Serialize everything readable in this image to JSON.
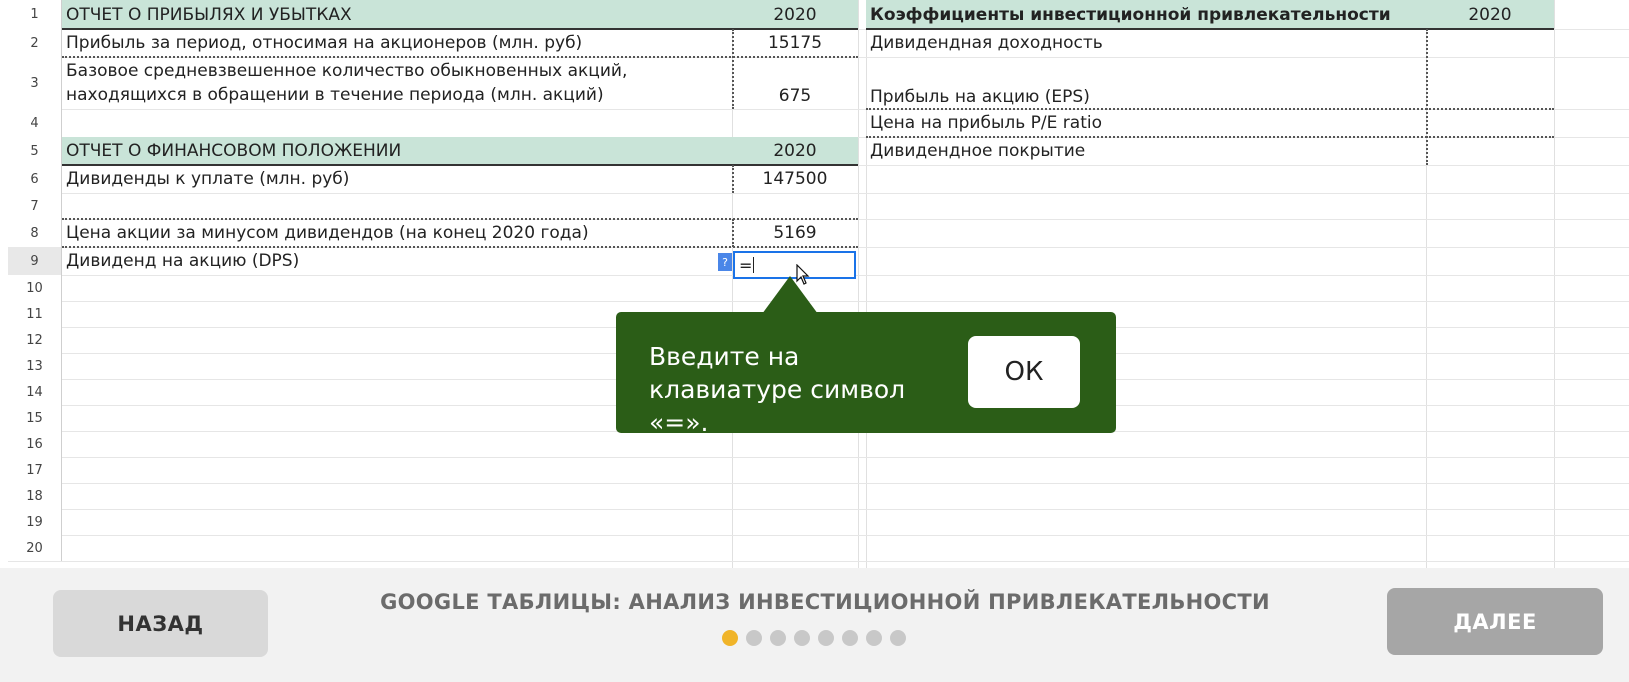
{
  "sheet": {
    "row_numbers": [
      "1",
      "2",
      "3",
      "4",
      "5",
      "6",
      "7",
      "8",
      "9",
      "10",
      "11",
      "12",
      "13",
      "14",
      "15",
      "16",
      "17",
      "18",
      "19",
      "20"
    ],
    "left_table": {
      "r1_label": "ОТЧЕТ О ПРИБЫЛЯХ И УБЫТКАХ",
      "r1_year": "2020",
      "r2_label": "Прибыль за период, относимая на акционеров (млн. руб)",
      "r2_value": "15175",
      "r3_label": "Базовое средневзвешенное количество обыкновенных акций, находящихся в обращении в течение периода (млн. акций)",
      "r3_value": "675",
      "r5_label": "ОТЧЕТ О ФИНАНСОВОМ ПОЛОЖЕНИИ",
      "r5_year": "2020",
      "r6_label": "Дивиденды к уплате (млн. руб)",
      "r6_value": "147500",
      "r8_label": "Цена акции за минусом дивидендов (на конец 2020 года)",
      "r8_value": "5169",
      "r9_label": "Дивиденд на акцию (DPS)",
      "r9_value": "="
    },
    "right_table": {
      "header": "Коэффициенты инвестиционной привлекательности",
      "year": "2020",
      "r2": "Дивидендная доходность",
      "r3": "Прибыль на акцию (EPS)",
      "r4": "Цена на прибыль P/E ratio",
      "r5": "Дивидендное покрытие"
    },
    "help_badge": "?"
  },
  "tooltip": {
    "text": "Введите на клавиатуре символ «=».",
    "ok_label": "ОК"
  },
  "footer": {
    "back_label": "НАЗАД",
    "title": "GOOGLE ТАБЛИЦЫ: АНАЛИЗ ИНВЕСТИЦИОННОЙ ПРИВЛЕКАТЕЛЬНОСТИ",
    "next_label": "ДАЛЕЕ",
    "progress": {
      "current_step": 1,
      "total_steps": 8
    }
  },
  "colors": {
    "header_fill": "#c9e4d8",
    "tooltip_bg": "#2b5d17",
    "active_dot": "#f0b429",
    "selection_border": "#1a73e8"
  }
}
